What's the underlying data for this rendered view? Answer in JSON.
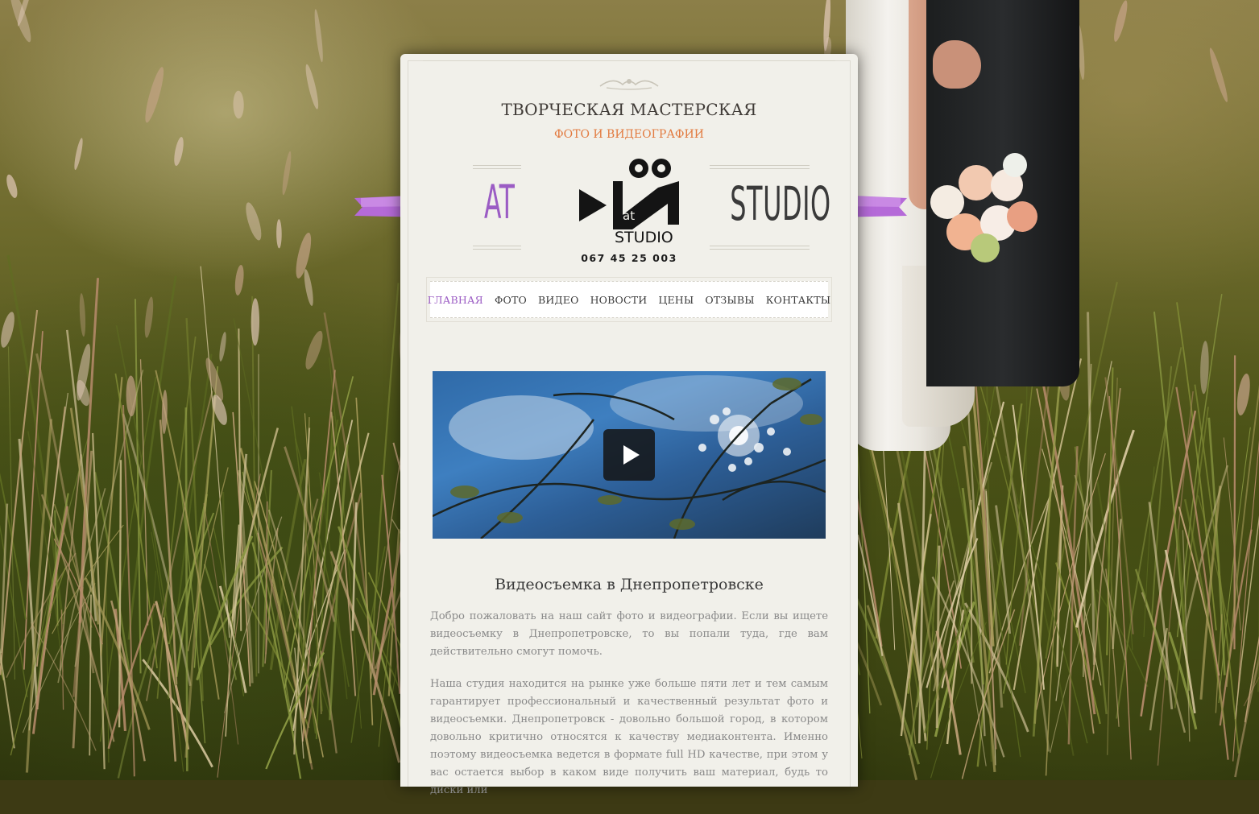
{
  "header": {
    "title": "ТВОРЧЕСКАЯ МАСТЕРСКАЯ",
    "subtitle": "ФОТО И ВИДЕОГРАФИИ",
    "badge_left": "AT",
    "badge_right": "STUDIO",
    "logo_small": "at",
    "logo_word": "STUDIO",
    "phone": "067 45 25 003"
  },
  "nav": {
    "items": [
      {
        "label": "ГЛАВНАЯ",
        "active": true
      },
      {
        "label": "ФОТО"
      },
      {
        "label": "ВИДЕО"
      },
      {
        "label": "НОВОСТИ"
      },
      {
        "label": "ЦЕНЫ"
      },
      {
        "label": "ОТЗЫВЫ"
      },
      {
        "label": "КОНТАКТЫ"
      }
    ]
  },
  "main": {
    "heading": "Видеосъемка в Днепропетровске",
    "paragraphs": [
      "Добро пожаловать на наш сайт фото и видеографии. Если вы ищете видеосъемку в Днепропетровске, то вы попали туда, где вам действительно смогут помочь.",
      "Наша студия находится на рынке уже больше пяти лет и тем самым гарантирует профессиональный и качественный результат фото и видеосъемки. Днепропетровск - довольно большой город, в котором довольно критично относятся к качеству медиаконтента. Именно поэтому видеосъемка ведется в формате full HD качестве, при этом у вас остается выбор в каком виде получить ваш материал, будь то диски или"
    ]
  },
  "colors": {
    "accent_purple": "#9b5cc4",
    "accent_orange": "#e27a3f",
    "paper": "#f1f0ea",
    "ribbon": "#c27de0"
  },
  "icons": {
    "play": "play-icon",
    "ribbon": "ribbon-decoration",
    "ornament": "flourish-ornament"
  }
}
